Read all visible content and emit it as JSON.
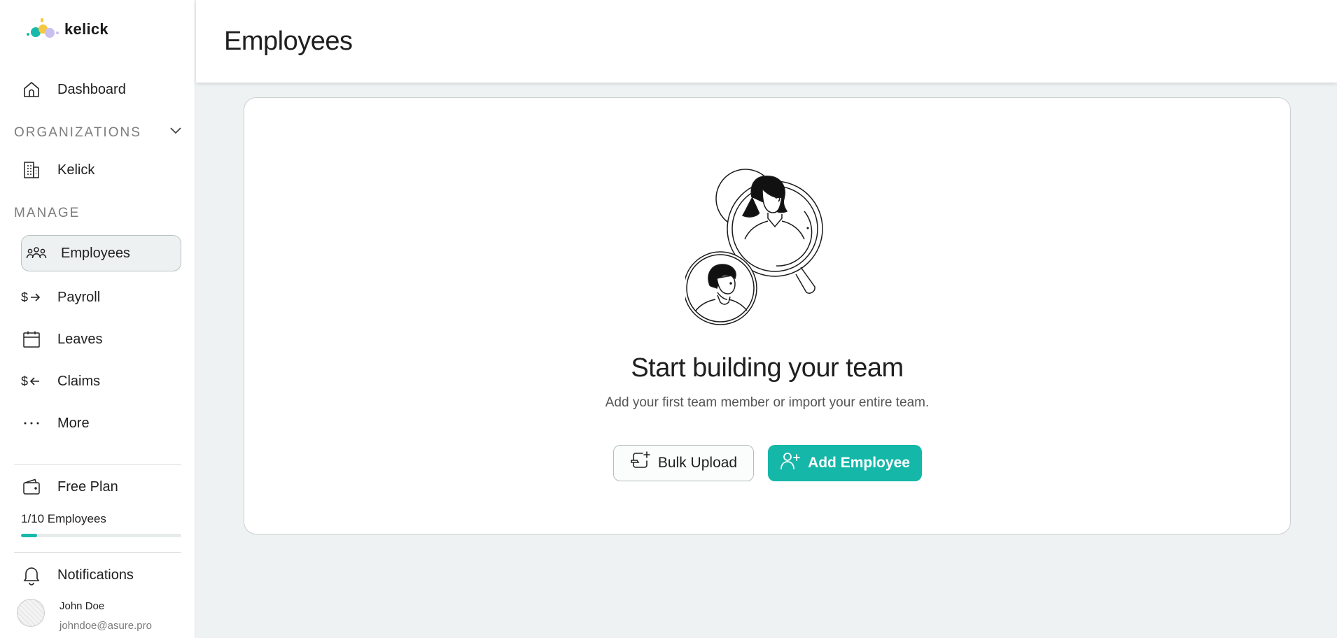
{
  "brand": {
    "name": "kelick"
  },
  "sidebar": {
    "dashboard": {
      "label": "Dashboard",
      "icon": "home-icon"
    },
    "organizations_heading": "ORGANIZATIONS",
    "organization": {
      "label": "Kelick",
      "icon": "building-icon"
    },
    "manage_heading": "MANAGE",
    "items": [
      {
        "label": "Employees",
        "icon": "users-icon",
        "active": true
      },
      {
        "label": "Payroll",
        "icon": "dollar-arrow-right-icon"
      },
      {
        "label": "Leaves",
        "icon": "calendar-icon"
      },
      {
        "label": "Claims",
        "icon": "dollar-arrow-left-icon"
      },
      {
        "label": "More",
        "icon": "ellipsis-icon"
      }
    ],
    "plan": {
      "label": "Free Plan",
      "icon": "wallet-icon",
      "usage": "1/10 Employees",
      "usage_fraction": 0.1
    },
    "notifications": {
      "label": "Notifications",
      "icon": "bell-icon"
    },
    "user": {
      "name": "John Doe",
      "email": "johndoe@asure.pro"
    }
  },
  "header": {
    "title": "Employees"
  },
  "empty_state": {
    "title": "Start building your team",
    "subtitle": "Add your first team member or import your entire team.",
    "bulk_upload_label": "Bulk Upload",
    "add_employee_label": "Add Employee"
  },
  "colors": {
    "accent": "#15b7a9",
    "background": "#eff2f2"
  }
}
